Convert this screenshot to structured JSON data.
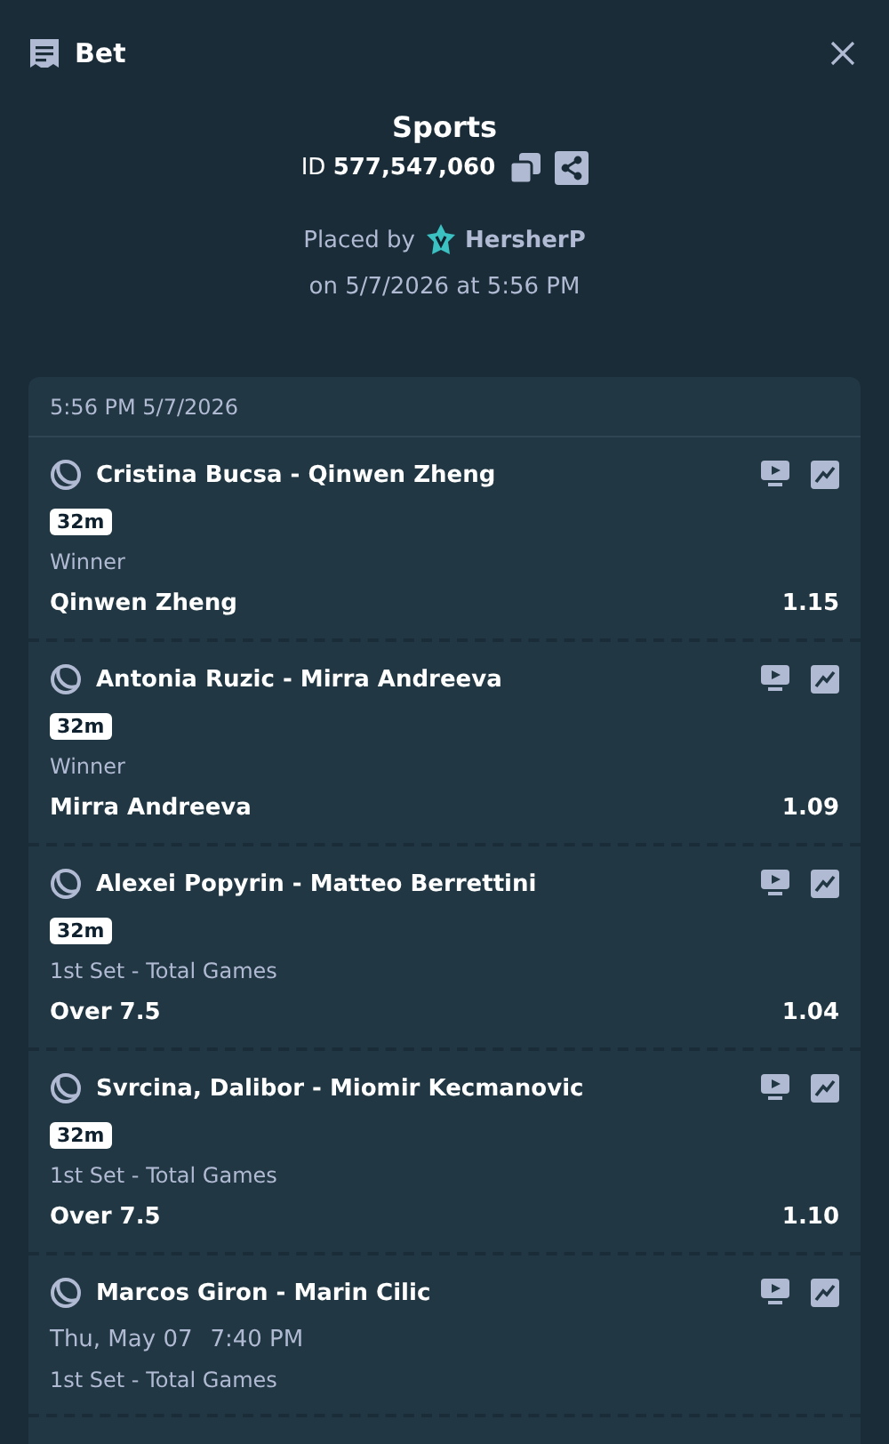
{
  "header": {
    "title": "Bet"
  },
  "bet": {
    "category": "Sports",
    "id_label": "ID",
    "id": "577,547,060",
    "placed_by_label": "Placed by",
    "user": "HersherP",
    "placed_on": "on 5/7/2026 at 5:56 PM"
  },
  "slip": {
    "timestamp": "5:56 PM 5/7/2026",
    "legs": [
      {
        "kind": "live",
        "event": "Cristina Bucsa - Qinwen Zheng",
        "badge": "32m",
        "market": "Winner",
        "selection": "Qinwen Zheng",
        "odds": "1.15"
      },
      {
        "kind": "live",
        "event": "Antonia Ruzic - Mirra Andreeva",
        "badge": "32m",
        "market": "Winner",
        "selection": "Mirra Andreeva",
        "odds": "1.09"
      },
      {
        "kind": "live",
        "event": "Alexei Popyrin - Matteo Berrettini",
        "badge": "32m",
        "market": "1st Set - Total Games",
        "selection": "Over 7.5",
        "odds": "1.04"
      },
      {
        "kind": "live",
        "event": "Svrcina, Dalibor - Miomir Kecmanovic",
        "badge": "32m",
        "market": "1st Set - Total Games",
        "selection": "Over 7.5",
        "odds": "1.10"
      },
      {
        "kind": "upcoming",
        "event": "Marcos Giron - Marin Cilic",
        "start_date": "Thu, May 07",
        "start_time": "7:40 PM",
        "market": "1st Set - Total Games"
      }
    ]
  }
}
